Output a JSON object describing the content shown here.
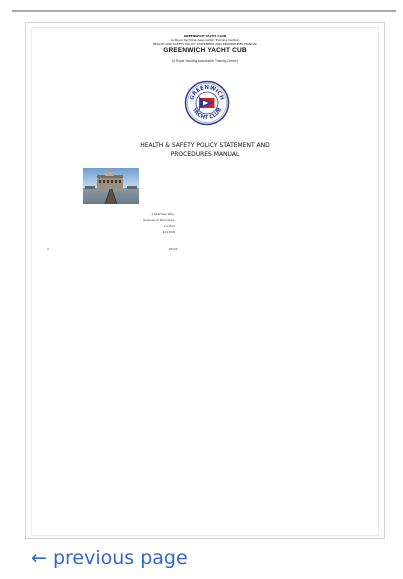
{
  "header": {
    "club_line": "GREENWICH YACHT CLUB",
    "affiliation_line": "(a Royal Yachting Association Training Centre)",
    "policy_line": "HEALTH AND SAFETY POLICY STATEMENT AND PROCEDURES MANUAL"
  },
  "document": {
    "club_title": "GREENWICH YACHT CUB",
    "club_subtitle": "(A Royal Yachting Association Training Centre)",
    "logo_text_top": "GREENWICH",
    "logo_text_bottom": "YACHT CLUB",
    "policy_title_line1": "HEALTH & SAFETY POLICY STATEMENT AND",
    "policy_title_line2": "PROCEDURES MANUAL",
    "address": {
      "line1": "1 Peartree Way,",
      "line2": "Greenwich Peninsula,",
      "line3": "London",
      "line4": "2013/06"
    },
    "footer_left": "2",
    "footer_right": "06/29"
  },
  "nav": {
    "previous_label": "← previous page"
  },
  "colors": {
    "link": "#3366cc",
    "logo_blue": "#2b3a9a",
    "logo_red": "#d22222"
  }
}
